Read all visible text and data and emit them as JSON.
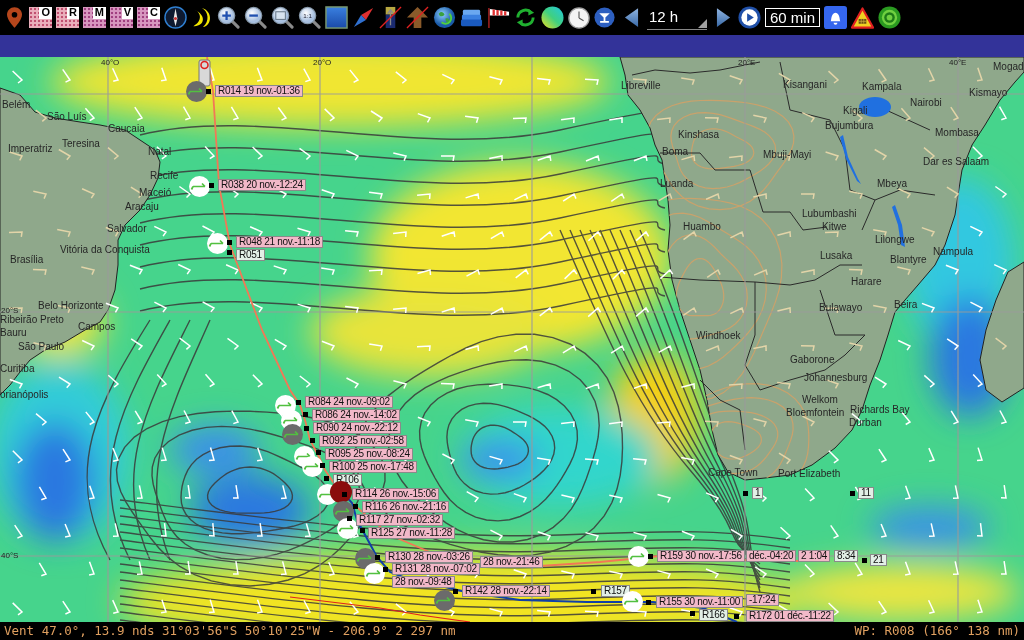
{
  "toolbar": {
    "chart_tiles": [
      {
        "letter": "O"
      },
      {
        "letter": "R"
      },
      {
        "letter": "M"
      },
      {
        "letter": "V"
      },
      {
        "letter": "C"
      }
    ],
    "zoom_actual_label": "1:1",
    "step_dropdown": {
      "value": "12 h"
    },
    "interval_field": {
      "value": "60 min"
    }
  },
  "map": {
    "grid_labels": [
      "40°O",
      "20°O",
      "20°E",
      "40°E",
      "20°S",
      "40°S"
    ],
    "cities": [
      "Belém",
      "São Luís",
      "Caucaia",
      "Imperatriz",
      "Teresina",
      "Natal",
      "Recife",
      "Maceió",
      "Aracaju",
      "Salvador",
      "Brasília",
      "Vitória da Conquista",
      "Belo Horizonte",
      "Ribeirão Preto",
      "Campos",
      "Bauru",
      "São Paulo",
      "Curitiba",
      "orianópolis",
      "Mogad",
      "Libreville",
      "Kisangani",
      "Kampala",
      "Kismayo",
      "Nairobi",
      "Kigali",
      "Bujumbura",
      "Kinshasa",
      "Mombasa",
      "Boma",
      "Mbuji-Mayi",
      "Dar es Salaam",
      "Luanda",
      "Mbeya",
      "Lubumbashi",
      "Huambo",
      "Kitwe",
      "Lilongwe",
      "Lusaka",
      "Blantyre",
      "Nampula",
      "Harare",
      "Bulawayo",
      "Beira",
      "Windhoek",
      "Gaborone",
      "Johannesburg",
      "Welkom",
      "Bloemfontein",
      "Richards Bay",
      "Durban",
      "Cape Town",
      "Port Elizabeth"
    ],
    "waypoints": [
      {
        "label": "R014 19 nov.-01:36",
        "kind": "timed",
        "color": "#6b6b6b",
        "current": false
      },
      {
        "label": "R038 20 nov.-12:24",
        "kind": "timed",
        "color": "#ffffff",
        "current": false
      },
      {
        "label": "R048 21 nov.-11:18",
        "kind": "timed",
        "color": "#ffffff",
        "current": false
      },
      {
        "label": "R051",
        "kind": "plain",
        "current": false
      },
      {
        "label": "R084 24 nov.-09:02",
        "kind": "timed",
        "color": "#ffffff",
        "current": false
      },
      {
        "label": "R086 24 nov.-14:02",
        "kind": "timed",
        "color": "#ffffff",
        "current": false
      },
      {
        "label": "R090 24 nov.-22:12",
        "kind": "timed",
        "color": "#6b6b6b",
        "current": false
      },
      {
        "label": "R092 25 nov.-02:58",
        "kind": "timed",
        "current": false
      },
      {
        "label": "R095 25 nov.-08:24",
        "kind": "timed",
        "color": "#ffffff",
        "current": false
      },
      {
        "label": "R100 25 nov.-17:48",
        "kind": "timed",
        "color": "#ffffff",
        "current": false
      },
      {
        "label": "R106",
        "kind": "plain",
        "color": "#ffffff",
        "current": false
      },
      {
        "label": "R114 26 nov.-15:06",
        "kind": "timed",
        "color": "#8a0c0c",
        "current": true
      },
      {
        "label": "R116 26 nov.-21:16",
        "kind": "timed",
        "color": "#6b6b6b",
        "current": false
      },
      {
        "label": "R117 27 nov.-02:32",
        "kind": "timed",
        "color": "#ffffff",
        "current": false
      },
      {
        "label": "R125 27 nov.-11:28",
        "kind": "timed",
        "current": false
      },
      {
        "label": "R130 28 nov.-03:26",
        "kind": "timed",
        "color": "#6b6b6b",
        "current": false
      },
      {
        "label": "28 nov.-21:46",
        "kind": "timed",
        "current": false
      },
      {
        "label": "R131 28 nov.-07:02",
        "kind": "timed",
        "color": "#ffffff",
        "current": false
      },
      {
        "label": "28 nov.-09:48",
        "kind": "timed",
        "current": false
      },
      {
        "label": "R142 28 nov.-22:14",
        "kind": "timed",
        "color": "#6b6b6b",
        "current": false
      },
      {
        "label": "R157",
        "kind": "plain",
        "current": false
      },
      {
        "label": "R159 30 nov.-17:56",
        "kind": "timed",
        "color": "#ffffff",
        "current": false
      },
      {
        "label": "déc.-04:20",
        "kind": "timed",
        "current": false
      },
      {
        "label": "2 1:04",
        "kind": "timed",
        "current": false
      },
      {
        "label": "8:34",
        "kind": "plain",
        "current": false
      },
      {
        "label": "R155 30 nov.-11:00",
        "kind": "timed",
        "color": "#ffffff",
        "current": false
      },
      {
        "label": "-17:24",
        "kind": "timed",
        "current": false
      },
      {
        "label": "R166",
        "kind": "plain",
        "current": false
      },
      {
        "label": "R172 01 déc.-11:22",
        "kind": "timed",
        "current": false
      },
      {
        "label": "1",
        "kind": "plain",
        "current": false
      },
      {
        "label": "11",
        "kind": "plain",
        "current": false
      },
      {
        "label": "21",
        "kind": "plain",
        "current": false
      }
    ]
  },
  "status_bar": {
    "readout": "Vent 47.0°, 13.9 nds 31°03'56\"S 50°10'25\"W - 206.9° 2 297 nm",
    "waypoint": "WP: R008 (166° 138 nm)"
  }
}
